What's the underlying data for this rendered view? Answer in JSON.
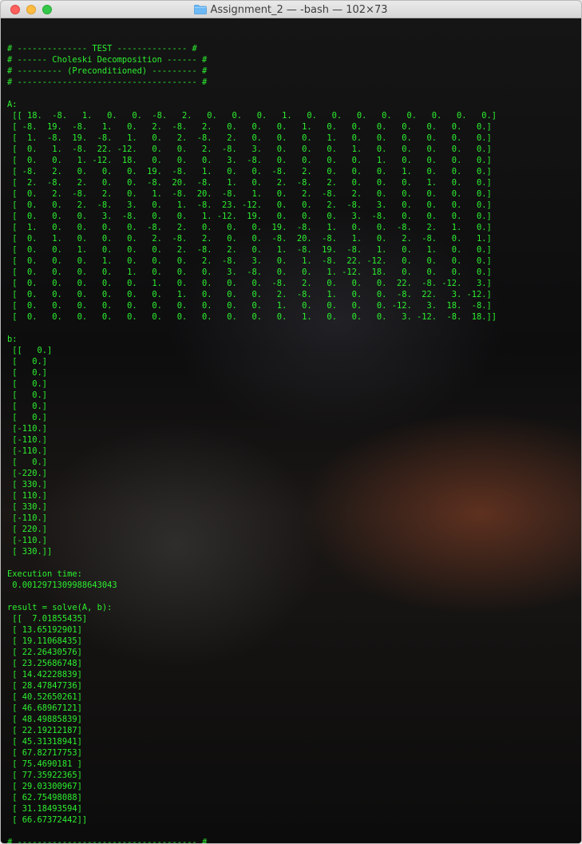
{
  "window": {
    "title": "Assignment_2 — -bash — 102×73"
  },
  "icons": {
    "folder": "folder-icon",
    "close": "close-icon",
    "minimize": "minimize-icon",
    "zoom": "zoom-icon"
  },
  "colors": {
    "terminal_text": "#2cf02f",
    "close": "#fc615d",
    "minimize": "#fdbc40",
    "zoom": "#34c84a"
  },
  "terminal": {
    "lines": [
      "",
      "# -------------- TEST -------------- #",
      "# ------ Choleski Decomposition ------ #",
      "# --------- (Preconditioned) --------- #",
      "# ------------------------------------ #",
      "",
      "A:",
      " [[ 18.  -8.   1.   0.   0.  -8.   2.   0.   0.   0.   1.   0.   0.   0.   0.   0.   0.   0.   0.]",
      " [ -8.  19.  -8.   1.   0.   2.  -8.   2.   0.   0.   0.   1.   0.   0.   0.   0.   0.   0.   0.]",
      " [  1.  -8.  19.  -8.   1.   0.   2.  -8.   2.   0.   0.   0.   1.   0.   0.   0.   0.   0.   0.]",
      " [  0.   1.  -8.  22. -12.   0.   0.   2.  -8.   3.   0.   0.   0.   1.   0.   0.   0.   0.   0.]",
      " [  0.   0.   1. -12.  18.   0.   0.   0.   3.  -8.   0.   0.   0.   0.   1.   0.   0.   0.   0.]",
      " [ -8.   2.   0.   0.   0.  19.  -8.   1.   0.   0.  -8.   2.   0.   0.   0.   1.   0.   0.   0.]",
      " [  2.  -8.   2.   0.   0.  -8.  20.  -8.   1.   0.   2.  -8.   2.   0.   0.   0.   1.   0.   0.]",
      " [  0.   2.  -8.   2.   0.   1.  -8.  20.  -8.   1.   0.   2.  -8.   2.   0.   0.   0.   0.   0.]",
      " [  0.   0.   2.  -8.   3.   0.   1.  -8.  23. -12.   0.   0.   2.  -8.   3.   0.   0.   0.   0.]",
      " [  0.   0.   0.   3.  -8.   0.   0.   1. -12.  19.   0.   0.   0.   3.  -8.   0.   0.   0.   0.]",
      " [  1.   0.   0.   0.   0.  -8.   2.   0.   0.   0.  19.  -8.   1.   0.   0.  -8.   2.   1.   0.]",
      " [  0.   1.   0.   0.   0.   2.  -8.   2.   0.   0.  -8.  20.  -8.   1.   0.   2.  -8.   0.   1.]",
      " [  0.   0.   1.   0.   0.   0.   2.  -8.   2.   0.   1.  -8.  19.  -8.   1.   0.   1.   0.   0.]",
      " [  0.   0.   0.   1.   0.   0.   0.   2.  -8.   3.   0.   1.  -8.  22. -12.   0.   0.   0.   0.]",
      " [  0.   0.   0.   0.   1.   0.   0.   0.   3.  -8.   0.   0.   1. -12.  18.   0.   0.   0.   0.]",
      " [  0.   0.   0.   0.   0.   1.   0.   0.   0.   0.  -8.   2.   0.   0.   0.  22.  -8. -12.   3.]",
      " [  0.   0.   0.   0.   0.   0.   1.   0.   0.   0.   2.  -8.   1.   0.   0.  -8.  22.   3. -12.]",
      " [  0.   0.   0.   0.   0.   0.   0.   0.   0.   0.   1.   0.   0.   0.   0. -12.   3.  18.  -8.]",
      " [  0.   0.   0.   0.   0.   0.   0.   0.   0.   0.   0.   1.   0.   0.   0.   3. -12.  -8.  18.]]",
      "",
      "b:",
      " [[   0.]",
      " [   0.]",
      " [   0.]",
      " [   0.]",
      " [   0.]",
      " [   0.]",
      " [   0.]",
      " [-110.]",
      " [-110.]",
      " [-110.]",
      " [   0.]",
      " [-220.]",
      " [ 330.]",
      " [ 110.]",
      " [ 330.]",
      " [-110.]",
      " [ 220.]",
      " [-110.]",
      " [ 330.]]",
      "",
      "Execution time:",
      " 0.0012971309988643043",
      "",
      "result = solve(A, b):",
      " [[  7.01855435]",
      " [ 13.65192901]",
      " [ 19.11068435]",
      " [ 22.26430576]",
      " [ 23.25686748]",
      " [ 14.42228839]",
      " [ 28.47847736]",
      " [ 40.52650261]",
      " [ 46.68967121]",
      " [ 48.49885839]",
      " [ 22.19212187]",
      " [ 45.31318941]",
      " [ 67.82717753]",
      " [ 75.4690181 ]",
      " [ 77.35922365]",
      " [ 29.03300967]",
      " [ 62.75498088]",
      " [ 31.18493594]",
      " [ 66.67372442]]",
      "",
      "# ------------------------------------ #"
    ]
  }
}
